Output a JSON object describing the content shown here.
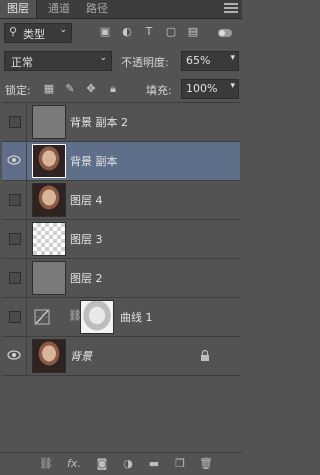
{
  "tabs": [
    {
      "label": "图层",
      "active": true
    },
    {
      "label": "通道",
      "active": false
    },
    {
      "label": "路径",
      "active": false
    }
  ],
  "filter": {
    "kind_label": "类型",
    "icons": [
      "image-filter-icon",
      "adjustment-filter-icon",
      "type-filter-icon",
      "shape-filter-icon",
      "smart-object-filter-icon",
      "toggle-filter-icon"
    ]
  },
  "blend": {
    "mode": "正常",
    "opacity_label": "不透明度:",
    "opacity_value": "65%"
  },
  "lock": {
    "label": "锁定:",
    "fill_label": "填充:",
    "fill_value": "100%"
  },
  "layers": [
    {
      "name": "背景 副本 2",
      "visible": false,
      "selected": false,
      "thumb": "gray"
    },
    {
      "name": "背景 副本",
      "visible": true,
      "selected": true,
      "thumb": "face"
    },
    {
      "name": "图层 4",
      "visible": false,
      "selected": false,
      "thumb": "face"
    },
    {
      "name": "图层 3",
      "visible": false,
      "selected": false,
      "thumb": "checker"
    },
    {
      "name": "图层 2",
      "visible": false,
      "selected": false,
      "thumb": "gray"
    },
    {
      "name": "曲线 1",
      "visible": false,
      "selected": false,
      "thumb": "adjustment"
    },
    {
      "name": "背景",
      "visible": true,
      "selected": false,
      "thumb": "face",
      "locked": true
    }
  ],
  "footer": {
    "fx_label": "fx."
  }
}
